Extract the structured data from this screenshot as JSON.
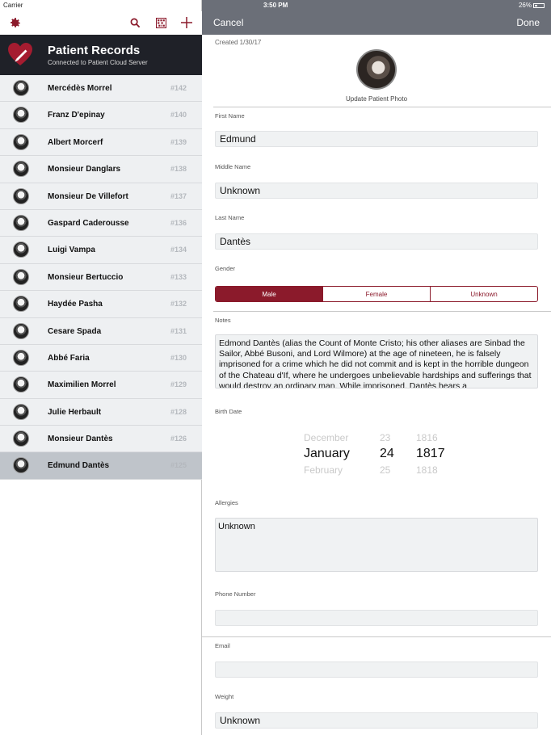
{
  "status": {
    "carrier": "Carrier",
    "time": "3:50 PM",
    "battery": "26%"
  },
  "left": {
    "toolbar": {
      "settings_icon": "gear-icon",
      "search_icon": "search-icon",
      "qr_icon": "qr-icon",
      "add_icon": "plus-icon"
    },
    "header": {
      "title": "Patient Records",
      "subtitle": "Connected to Patient Cloud Server"
    },
    "patients": [
      {
        "name": "Mercédès Morrel",
        "num": "#142"
      },
      {
        "name": "Franz D'epinay",
        "num": "#140"
      },
      {
        "name": "Albert Morcerf",
        "num": "#139"
      },
      {
        "name": "Monsieur Danglars",
        "num": "#138"
      },
      {
        "name": "Monsieur De Villefort",
        "num": "#137"
      },
      {
        "name": "Gaspard Caderousse",
        "num": "#136"
      },
      {
        "name": "Luigi Vampa",
        "num": "#134"
      },
      {
        "name": "Monsieur  Bertuccio",
        "num": "#133"
      },
      {
        "name": "Haydée Pasha",
        "num": "#132"
      },
      {
        "name": "Cesare Spada",
        "num": "#131"
      },
      {
        "name": "Abbé Faria",
        "num": "#130"
      },
      {
        "name": "Maximilien Morrel",
        "num": "#129"
      },
      {
        "name": "Julie Herbault",
        "num": "#128"
      },
      {
        "name": "Monsieur Dantès",
        "num": "#126"
      },
      {
        "name": "Edmund Dantès",
        "num": "#125"
      }
    ]
  },
  "right": {
    "cancel": "Cancel",
    "done": "Done",
    "created": "Created 1/30/17",
    "update_photo": "Update Patient Photo",
    "first_name_label": "First Name",
    "first_name": "Edmund",
    "middle_name_label": "Middle Name",
    "middle_name": "Unknown",
    "last_name_label": "Last Name",
    "last_name": "Dantès",
    "gender_label": "Gender",
    "gender_options": [
      "Male",
      "Female",
      "Unknown"
    ],
    "gender_selected": "Male",
    "notes_label": "Notes",
    "notes": "Edmond Dantès (alias the Count of Monte Cristo; his other aliases are Sinbad the Sailor, Abbé Busoni, and Lord Wilmore) at the age of nineteen, he is falsely imprisoned for a crime which he did not commit and is kept in the horrible dungeon of the Chateau d'If, where he undergoes unbelievable hardships and sufferings that would destroy an ordinary man. While imprisoned, Dantès hears a",
    "birth_date_label": "Birth Date",
    "birth_date_picker": {
      "month_prev": "December",
      "day_prev": "23",
      "year_prev": "1816",
      "month": "January",
      "day": "24",
      "year": "1817",
      "month_next": "February",
      "day_next": "25",
      "year_next": "1818"
    },
    "allergies_label": "Allergies",
    "allergies": "Unknown",
    "phone_label": "Phone Number",
    "phone": "",
    "email_label": "Email",
    "email": "",
    "weight_label": "Weight",
    "weight": "Unknown"
  },
  "colors": {
    "accent": "#8b1a2b",
    "nav_bar": "#6b6f78",
    "header_band": "#1f2128",
    "row_bg": "#eef0f2",
    "row_selected": "#bfc4ca"
  }
}
